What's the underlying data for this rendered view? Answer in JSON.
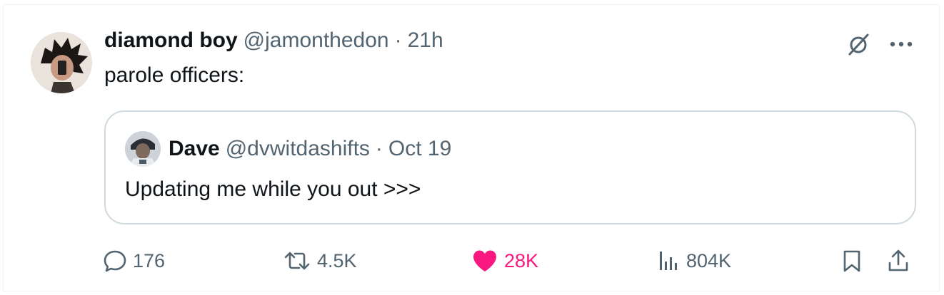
{
  "tweet": {
    "author_name": "diamond boy",
    "author_handle": "@jamonthedon",
    "separator": "·",
    "time": "21h",
    "text": "parole officers:"
  },
  "quoted_tweet": {
    "author_name": "Dave",
    "author_handle": "@dvwitdashifts",
    "separator": "·",
    "date": "Oct 19",
    "text": "Updating me while you out >>>"
  },
  "actions": {
    "replies": "176",
    "reposts": "4.5K",
    "likes": "28K",
    "views": "804K"
  },
  "colors": {
    "like_active": "#f91880",
    "secondary_text": "#536471",
    "border": "#cfd9de"
  },
  "icons": [
    "grok-icon",
    "more-icon",
    "reply-icon",
    "retweet-icon",
    "heart-icon",
    "views-icon",
    "bookmark-icon",
    "share-icon"
  ]
}
